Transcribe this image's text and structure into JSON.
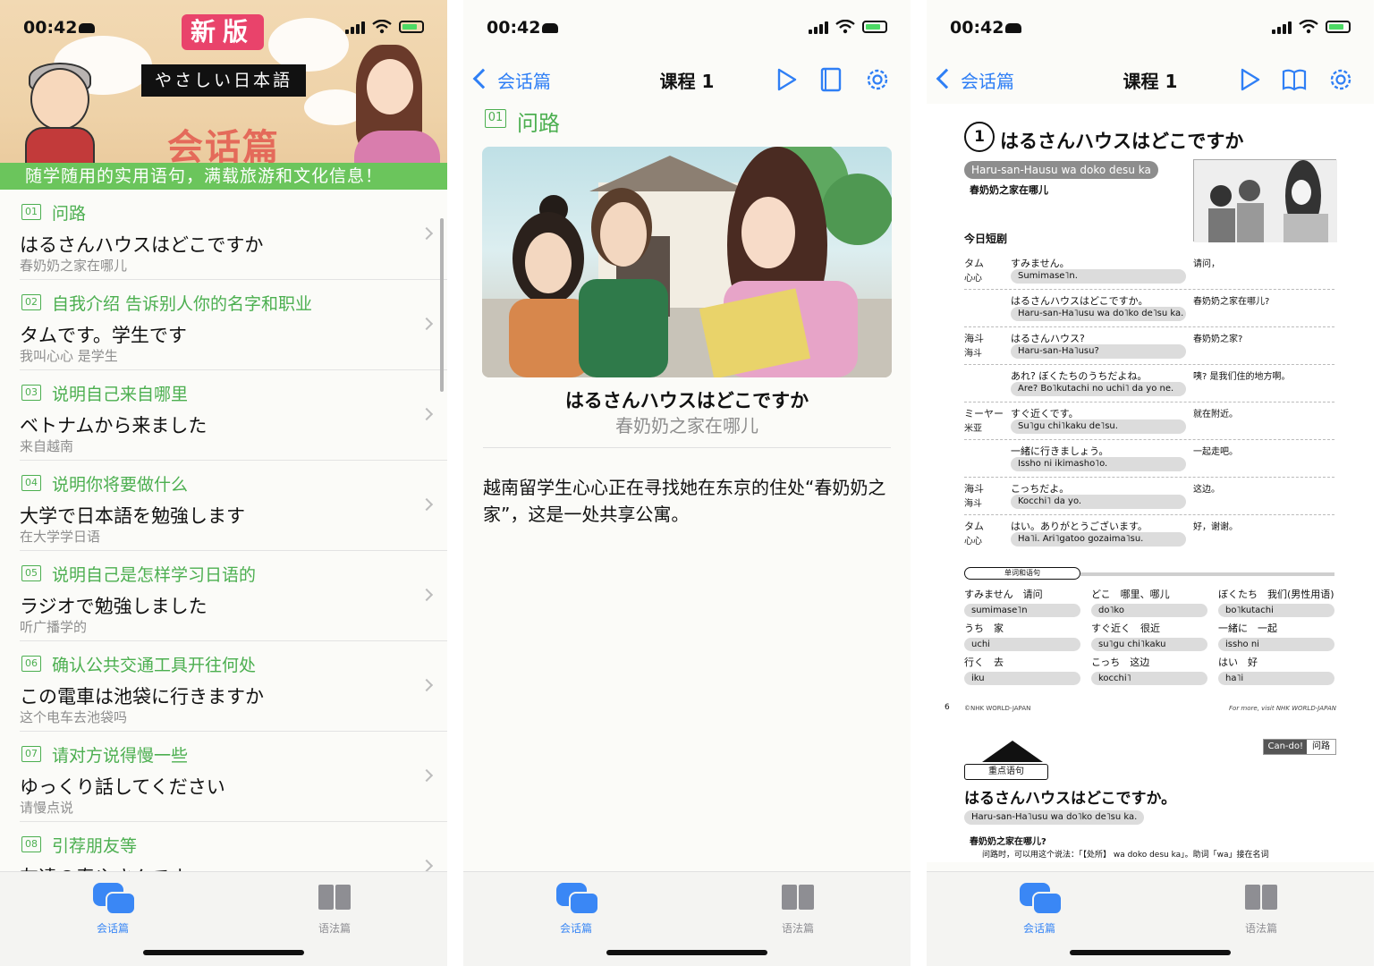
{
  "status": {
    "time": "00:42"
  },
  "home": {
    "badge": "新版",
    "subtitle": "やさしい日本語",
    "heading": "会话篇",
    "tagline": "随学随用的实用语句，满载旅游和文化信息！",
    "lessons": [
      {
        "num": "01",
        "category": "问路",
        "jp": "はるさんハウスはどこですか",
        "zh": "春奶奶之家在哪儿"
      },
      {
        "num": "02",
        "category": "自我介绍 告诉别人你的名字和职业",
        "jp": "タムです。学生です",
        "zh": "我叫心心 是学生"
      },
      {
        "num": "03",
        "category": "说明自己来自哪里",
        "jp": "ベトナムから来ました",
        "zh": "来自越南"
      },
      {
        "num": "04",
        "category": "说明你将要做什么",
        "jp": "大学で日本語を勉強します",
        "zh": "在大学学日语"
      },
      {
        "num": "05",
        "category": "说明自己是怎样学习日语的",
        "jp": "ラジオで勉強しました",
        "zh": "听广播学的"
      },
      {
        "num": "06",
        "category": "确认公共交通工具开往何处",
        "jp": "この電車は池袋に行きますか",
        "zh": "这个电车去池袋吗"
      },
      {
        "num": "07",
        "category": "请对方说得慢一些",
        "jp": "ゆっくり話してください",
        "zh": "请慢点说"
      },
      {
        "num": "08",
        "category": "引荐朋友等",
        "jp": "友達の春やさんです",
        "zh": ""
      }
    ]
  },
  "tabs": {
    "conversation": "会话篇",
    "grammar": "语法篇"
  },
  "nav": {
    "back": "会话篇",
    "title": "课程 1"
  },
  "lesson": {
    "num": "01",
    "category": "问路",
    "jp": "はるさんハウスはどこですか",
    "zh": "春奶奶之家在哪儿",
    "description": "越南留学生心心正在寻找她在东京的住处“春奶奶之家”，这是一处共享公寓。"
  },
  "textbook": {
    "lesson_no": "1",
    "title": "はるさんハウスはどこですか",
    "romaji": "Haru-san-Hausu wa doko desu ka",
    "zh": "春奶奶之家在哪儿",
    "section": "今日短剧",
    "dialog": [
      {
        "sp": "タム",
        "sp2": "心心",
        "jp": "すみません。",
        "ro": "Sumimase˥n.",
        "zh": "请问，"
      },
      {
        "sp": "",
        "sp2": "",
        "jp": "はるさんハウスはどこですか。",
        "ro": "Haru-san-Ha˥usu wa do˥ko de˥su ka.",
        "zh": "春奶奶之家在哪儿?"
      },
      {
        "sp": "海斗",
        "sp2": "海斗",
        "jp": "はるさんハウス?",
        "ro": "Haru-san-Ha˥usu?",
        "zh": "春奶奶之家?"
      },
      {
        "sp": "",
        "sp2": "",
        "jp": "あれ? ぼくたちのうちだよね。",
        "ro": "Are? Bo˥kutachi no uchi˥ da yo ne.",
        "zh": "咦? 是我们住的地方啊。"
      },
      {
        "sp": "ミーヤー",
        "sp2": "米亚",
        "jp": "すぐ近くです。",
        "ro": "Su˥gu chi˥kaku de˥su.",
        "zh": "就在附近。"
      },
      {
        "sp": "",
        "sp2": "",
        "jp": "一緒に行きましょう。",
        "ro": "Issho ni ikimasho˥o.",
        "zh": "一起走吧。"
      },
      {
        "sp": "海斗",
        "sp2": "海斗",
        "jp": "こっちだよ。",
        "ro": "Kocchi˥ da yo.",
        "zh": "这边。"
      },
      {
        "sp": "タム",
        "sp2": "心心",
        "jp": "はい。ありがとうございます。",
        "ro": "Ha˥i. Ari˥gatoo gozaima˥su.",
        "zh": "好，谢谢。"
      }
    ],
    "vocab_head": "单词和语句",
    "vocab": [
      {
        "w": "すみません　请问",
        "r": "sumimase˥n"
      },
      {
        "w": "どこ　哪里、哪儿",
        "r": "do˥ko"
      },
      {
        "w": "ぼくたち　我们(男性用语)",
        "r": "bo˥kutachi"
      },
      {
        "w": "うち　家",
        "r": "uchi"
      },
      {
        "w": "すぐ近く　很近",
        "r": "su˥gu chi˥kaku"
      },
      {
        "w": "一緒に　一起",
        "r": "issho ni"
      },
      {
        "w": "行く　去",
        "r": "iku"
      },
      {
        "w": "こっち　这边",
        "r": "kocchi˥"
      },
      {
        "w": "はい　好",
        "r": "ha˥i"
      }
    ],
    "page_no": "6",
    "copyright": "©NHK WORLD-JAPAN",
    "more": "For more, visit NHK WORLD-JAPAN",
    "cando": "Can-do!",
    "cando_topic": "问路",
    "key_head": "重点语句",
    "key_jp": "はるさんハウスはどこですか。",
    "key_ro": "Haru-san-Ha˥usu wa do˥ko de˥su ka.",
    "key_zh": "春奶奶之家在哪儿?",
    "key_note": "问路时，可以用这个说法：「【处所】 wa doko desu ka」。助词「wa」接在名词"
  }
}
